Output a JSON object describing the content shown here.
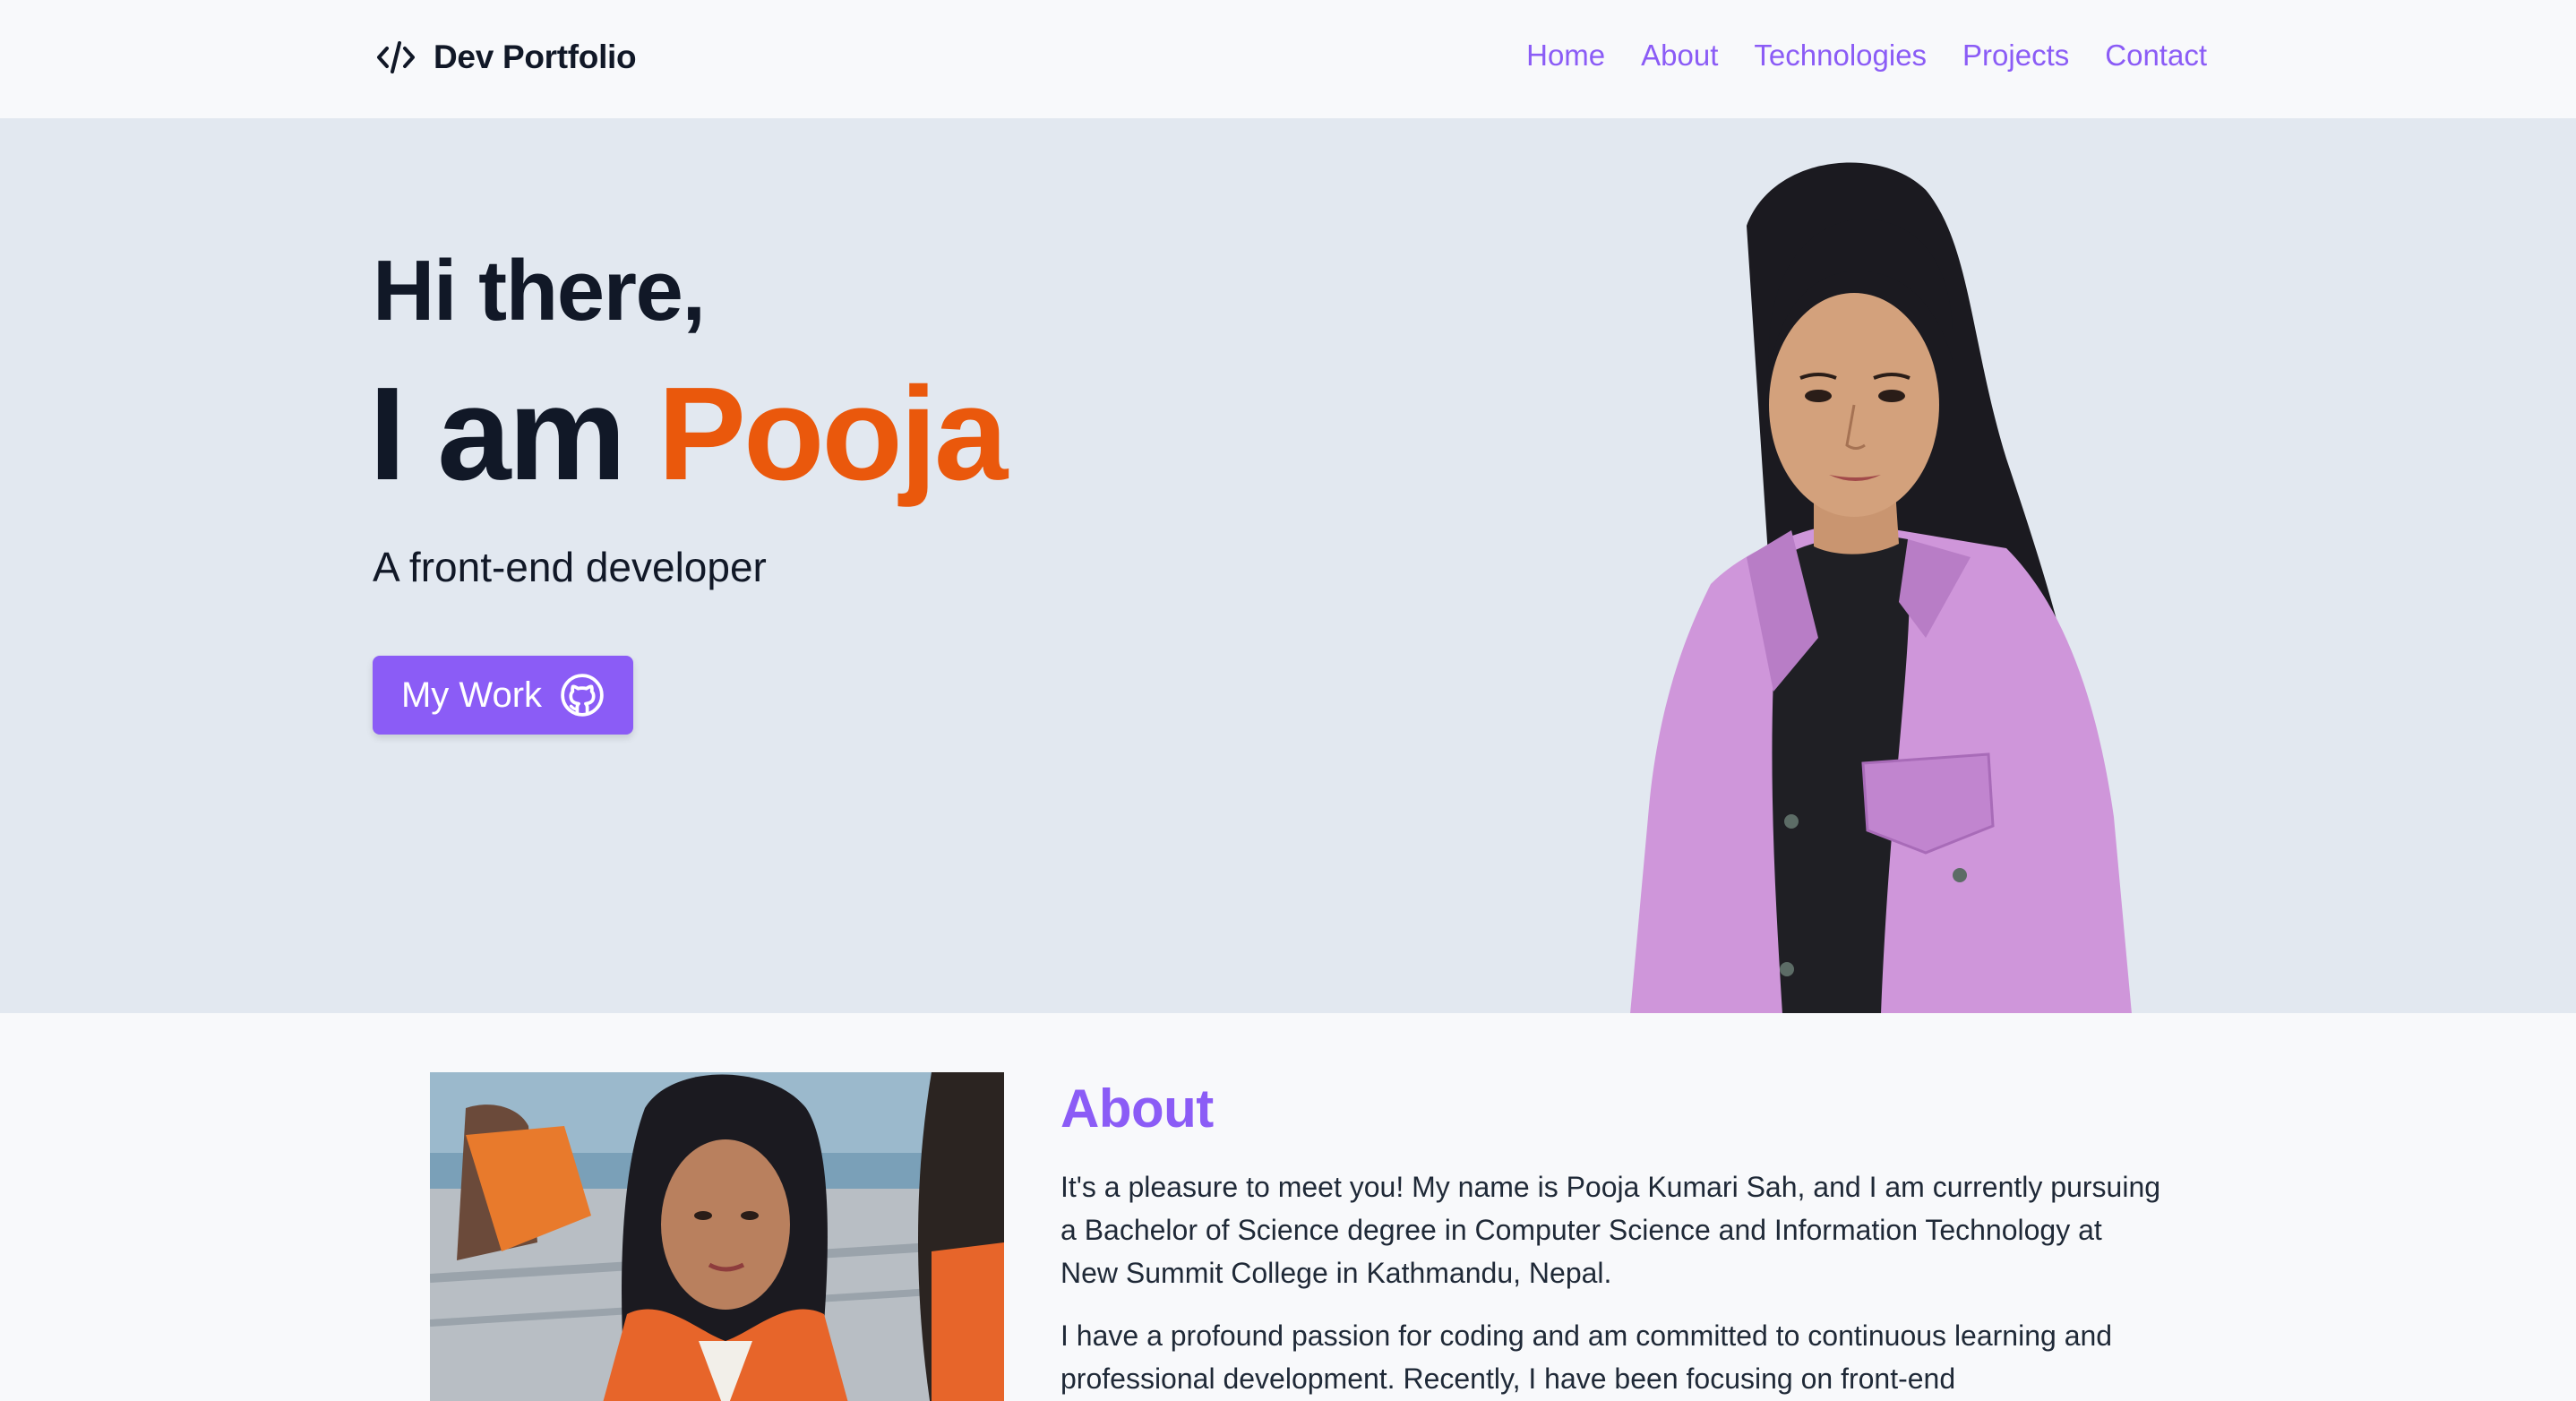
{
  "brand": {
    "title": "Dev Portfolio",
    "icon": "code-icon"
  },
  "nav": {
    "items": [
      {
        "label": "Home"
      },
      {
        "label": "About"
      },
      {
        "label": "Technologies"
      },
      {
        "label": "Projects"
      },
      {
        "label": "Contact"
      }
    ]
  },
  "hero": {
    "greeting": "Hi there,",
    "intro_prefix": "I am",
    "name": "Pooja",
    "role": "A front-end developer",
    "cta_label": "My Work",
    "cta_icon": "github-icon"
  },
  "about": {
    "title": "About",
    "paragraphs": [
      "It's a pleasure to meet you! My name is Pooja Kumari Sah, and I am currently pursuing a Bachelor of Science degree in Computer Science and Information Technology at New Summit College in Kathmandu, Nepal.",
      "I have a profound passion for coding and am committed to continuous learning and professional development. Recently, I have been focusing on front-end"
    ]
  },
  "colors": {
    "accent": "#8b5cf6",
    "name_highlight": "#ea580c",
    "hero_bg": "#e2e8f0",
    "page_bg": "#f8f9fb",
    "text": "#111827"
  }
}
